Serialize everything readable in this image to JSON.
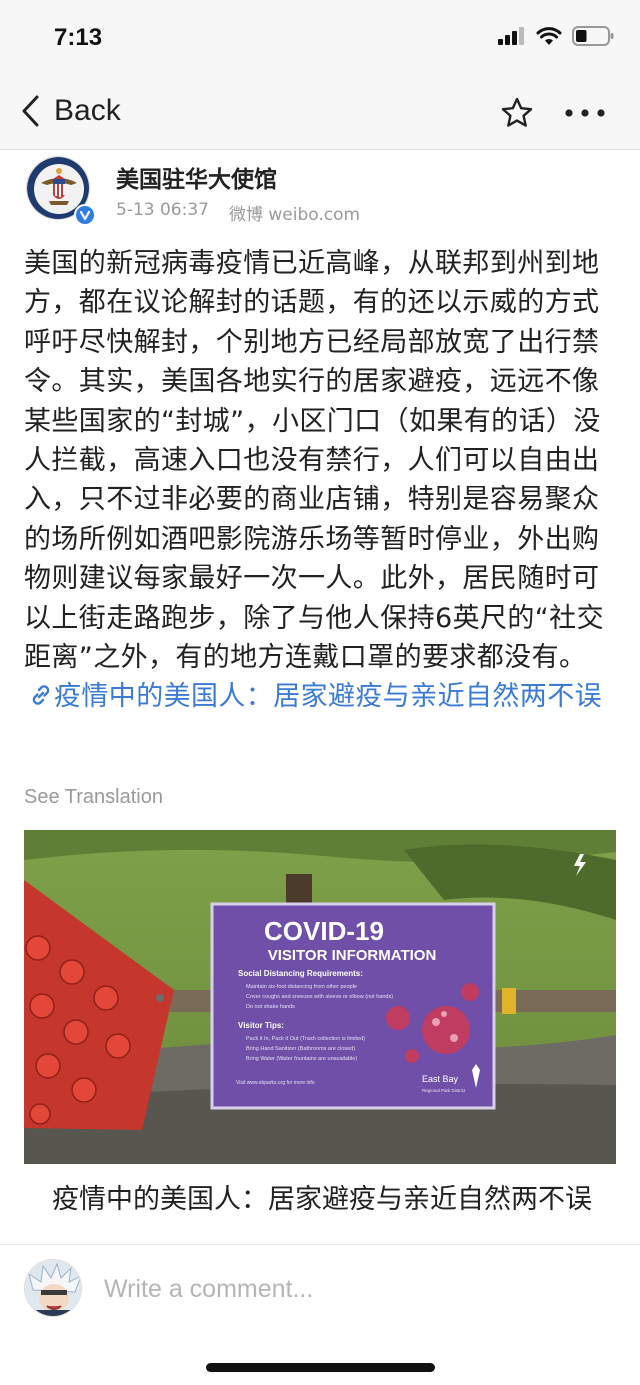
{
  "status_bar": {
    "time": "7:13",
    "battery_level": 0.35
  },
  "nav": {
    "back_label": "Back"
  },
  "post": {
    "author": "美国驻华大使馆",
    "date": "5-13 06:37",
    "source": "微博 weibo.com",
    "body_text": "美国的新冠病毒疫情已近高峰，从联邦到州到地方，都在议论解封的话题，有的还以示威的方式呼吁尽快解封，个别地方已经局部放宽了出行禁令。其实，美国各地实行的居家避疫，远远不像某些国家的“封城”，小区门口（如果有的话）没人拦截，高速入口也没有禁行，人们可以自由出入，只不过非必要的商业店铺，特别是容易聚众的场所例如酒吧影院游乐场等暂时停业，外出购物则建议每家最好一次一人。此外，居民随时可以上街走路跑步，除了与他人保持6英尺的“社交距离”之外，有的地方连戴口罩的要求都没有。",
    "link_text": "疫情中的美国人：居家避疫与亲近自然两不误",
    "see_translation": "See Translation"
  },
  "card": {
    "title": "疫情中的美国人：居家避疫与亲近自然两不误",
    "sign": {
      "title": "COVID-19",
      "subtitle": "VISITOR INFORMATION",
      "section1": "Social Distancing Requirements:",
      "items1": [
        "Maintain six-foot distancing from other people",
        "Cover coughs and sneezes with sleeve or elbow (not hands)",
        "Do not shake hands"
      ],
      "section2": "Visitor Tips:",
      "items2": [
        "Pack it In, Pack it Out (Trash collection is limited)",
        "Bring Hand Sanitizer (Bathrooms are closed)",
        "Bring Water (Water fountains are unavailable)"
      ],
      "footer": "Visit www.ebparks.org for more info",
      "brand": "East Bay",
      "brand_sub": "Regional Park District"
    }
  },
  "comment": {
    "placeholder": "Write a comment..."
  },
  "colors": {
    "link": "#3b7bd4",
    "verified": "#2f7de1",
    "sign_purple": "#6f4fa8"
  }
}
